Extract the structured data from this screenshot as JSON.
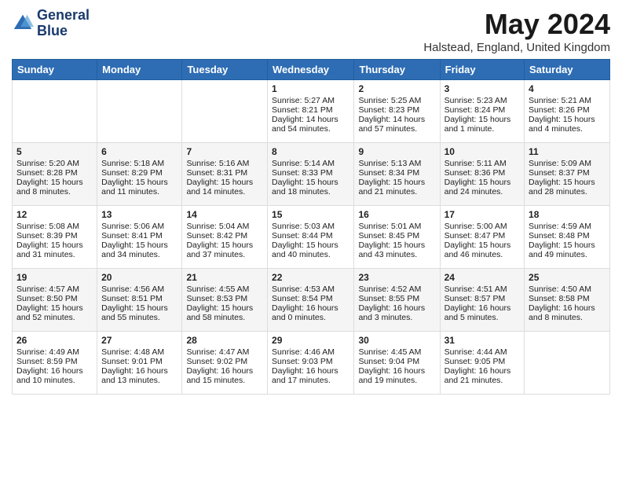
{
  "header": {
    "logo_line1": "General",
    "logo_line2": "Blue",
    "month_title": "May 2024",
    "location": "Halstead, England, United Kingdom"
  },
  "weekdays": [
    "Sunday",
    "Monday",
    "Tuesday",
    "Wednesday",
    "Thursday",
    "Friday",
    "Saturday"
  ],
  "weeks": [
    [
      {
        "day": "",
        "text": ""
      },
      {
        "day": "",
        "text": ""
      },
      {
        "day": "",
        "text": ""
      },
      {
        "day": "1",
        "text": "Sunrise: 5:27 AM\nSunset: 8:21 PM\nDaylight: 14 hours\nand 54 minutes."
      },
      {
        "day": "2",
        "text": "Sunrise: 5:25 AM\nSunset: 8:23 PM\nDaylight: 14 hours\nand 57 minutes."
      },
      {
        "day": "3",
        "text": "Sunrise: 5:23 AM\nSunset: 8:24 PM\nDaylight: 15 hours\nand 1 minute."
      },
      {
        "day": "4",
        "text": "Sunrise: 5:21 AM\nSunset: 8:26 PM\nDaylight: 15 hours\nand 4 minutes."
      }
    ],
    [
      {
        "day": "5",
        "text": "Sunrise: 5:20 AM\nSunset: 8:28 PM\nDaylight: 15 hours\nand 8 minutes."
      },
      {
        "day": "6",
        "text": "Sunrise: 5:18 AM\nSunset: 8:29 PM\nDaylight: 15 hours\nand 11 minutes."
      },
      {
        "day": "7",
        "text": "Sunrise: 5:16 AM\nSunset: 8:31 PM\nDaylight: 15 hours\nand 14 minutes."
      },
      {
        "day": "8",
        "text": "Sunrise: 5:14 AM\nSunset: 8:33 PM\nDaylight: 15 hours\nand 18 minutes."
      },
      {
        "day": "9",
        "text": "Sunrise: 5:13 AM\nSunset: 8:34 PM\nDaylight: 15 hours\nand 21 minutes."
      },
      {
        "day": "10",
        "text": "Sunrise: 5:11 AM\nSunset: 8:36 PM\nDaylight: 15 hours\nand 24 minutes."
      },
      {
        "day": "11",
        "text": "Sunrise: 5:09 AM\nSunset: 8:37 PM\nDaylight: 15 hours\nand 28 minutes."
      }
    ],
    [
      {
        "day": "12",
        "text": "Sunrise: 5:08 AM\nSunset: 8:39 PM\nDaylight: 15 hours\nand 31 minutes."
      },
      {
        "day": "13",
        "text": "Sunrise: 5:06 AM\nSunset: 8:41 PM\nDaylight: 15 hours\nand 34 minutes."
      },
      {
        "day": "14",
        "text": "Sunrise: 5:04 AM\nSunset: 8:42 PM\nDaylight: 15 hours\nand 37 minutes."
      },
      {
        "day": "15",
        "text": "Sunrise: 5:03 AM\nSunset: 8:44 PM\nDaylight: 15 hours\nand 40 minutes."
      },
      {
        "day": "16",
        "text": "Sunrise: 5:01 AM\nSunset: 8:45 PM\nDaylight: 15 hours\nand 43 minutes."
      },
      {
        "day": "17",
        "text": "Sunrise: 5:00 AM\nSunset: 8:47 PM\nDaylight: 15 hours\nand 46 minutes."
      },
      {
        "day": "18",
        "text": "Sunrise: 4:59 AM\nSunset: 8:48 PM\nDaylight: 15 hours\nand 49 minutes."
      }
    ],
    [
      {
        "day": "19",
        "text": "Sunrise: 4:57 AM\nSunset: 8:50 PM\nDaylight: 15 hours\nand 52 minutes."
      },
      {
        "day": "20",
        "text": "Sunrise: 4:56 AM\nSunset: 8:51 PM\nDaylight: 15 hours\nand 55 minutes."
      },
      {
        "day": "21",
        "text": "Sunrise: 4:55 AM\nSunset: 8:53 PM\nDaylight: 15 hours\nand 58 minutes."
      },
      {
        "day": "22",
        "text": "Sunrise: 4:53 AM\nSunset: 8:54 PM\nDaylight: 16 hours\nand 0 minutes."
      },
      {
        "day": "23",
        "text": "Sunrise: 4:52 AM\nSunset: 8:55 PM\nDaylight: 16 hours\nand 3 minutes."
      },
      {
        "day": "24",
        "text": "Sunrise: 4:51 AM\nSunset: 8:57 PM\nDaylight: 16 hours\nand 5 minutes."
      },
      {
        "day": "25",
        "text": "Sunrise: 4:50 AM\nSunset: 8:58 PM\nDaylight: 16 hours\nand 8 minutes."
      }
    ],
    [
      {
        "day": "26",
        "text": "Sunrise: 4:49 AM\nSunset: 8:59 PM\nDaylight: 16 hours\nand 10 minutes."
      },
      {
        "day": "27",
        "text": "Sunrise: 4:48 AM\nSunset: 9:01 PM\nDaylight: 16 hours\nand 13 minutes."
      },
      {
        "day": "28",
        "text": "Sunrise: 4:47 AM\nSunset: 9:02 PM\nDaylight: 16 hours\nand 15 minutes."
      },
      {
        "day": "29",
        "text": "Sunrise: 4:46 AM\nSunset: 9:03 PM\nDaylight: 16 hours\nand 17 minutes."
      },
      {
        "day": "30",
        "text": "Sunrise: 4:45 AM\nSunset: 9:04 PM\nDaylight: 16 hours\nand 19 minutes."
      },
      {
        "day": "31",
        "text": "Sunrise: 4:44 AM\nSunset: 9:05 PM\nDaylight: 16 hours\nand 21 minutes."
      },
      {
        "day": "",
        "text": ""
      }
    ]
  ]
}
